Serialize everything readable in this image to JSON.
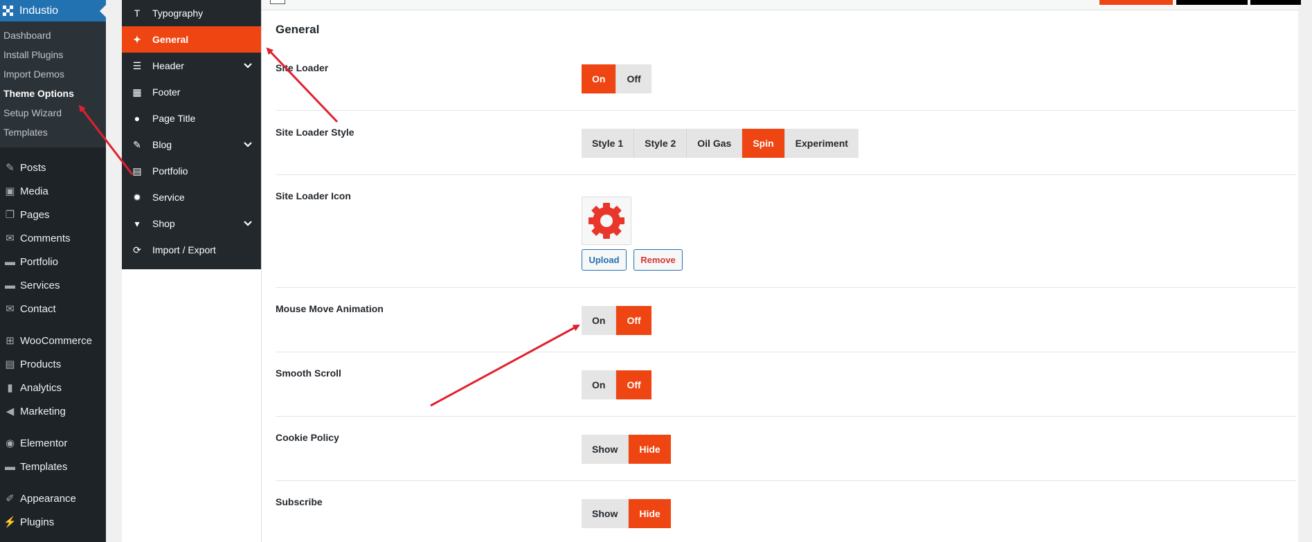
{
  "wp_menu": {
    "site_name": "Industio",
    "submenu": [
      "Dashboard",
      "Install Plugins",
      "Import Demos",
      "Theme Options",
      "Setup Wizard",
      "Templates"
    ],
    "current_submenu": "Theme Options",
    "items_group1": [
      {
        "label": "Posts",
        "icon": "pin-icon"
      },
      {
        "label": "Media",
        "icon": "media-icon"
      },
      {
        "label": "Pages",
        "icon": "pages-icon"
      },
      {
        "label": "Comments",
        "icon": "comments-icon"
      },
      {
        "label": "Portfolio",
        "icon": "folder-icon"
      },
      {
        "label": "Services",
        "icon": "folder-icon"
      },
      {
        "label": "Contact",
        "icon": "mail-icon"
      }
    ],
    "items_group2": [
      {
        "label": "WooCommerce",
        "icon": "woo-icon"
      },
      {
        "label": "Products",
        "icon": "archive-icon"
      },
      {
        "label": "Analytics",
        "icon": "bar-chart-icon"
      },
      {
        "label": "Marketing",
        "icon": "megaphone-icon"
      }
    ],
    "items_group3": [
      {
        "label": "Elementor",
        "icon": "elementor-icon"
      },
      {
        "label": "Templates",
        "icon": "folder-icon"
      }
    ],
    "items_group4": [
      {
        "label": "Appearance",
        "icon": "brush-icon"
      },
      {
        "label": "Plugins",
        "icon": "plug-icon"
      }
    ]
  },
  "options_nav": [
    {
      "label": "Typography",
      "icon": "text-icon",
      "has_children": false
    },
    {
      "label": "General",
      "icon": "wrench-icon",
      "has_children": false,
      "active": true
    },
    {
      "label": "Header",
      "icon": "indent-icon",
      "has_children": true
    },
    {
      "label": "Footer",
      "icon": "layout-icon",
      "has_children": false
    },
    {
      "label": "Page Title",
      "icon": "location-pin-icon",
      "has_children": false
    },
    {
      "label": "Blog",
      "icon": "edit-icon",
      "has_children": true
    },
    {
      "label": "Portfolio",
      "icon": "briefcase-icon",
      "has_children": false
    },
    {
      "label": "Service",
      "icon": "gear-icon",
      "has_children": false
    },
    {
      "label": "Shop",
      "icon": "cart-icon",
      "has_children": true
    },
    {
      "label": "Import / Export",
      "icon": "refresh-icon",
      "has_children": false
    }
  ],
  "section_title": "General",
  "options": {
    "site_loader": {
      "label": "Site Loader",
      "choices": [
        "On",
        "Off"
      ],
      "selected": "On"
    },
    "site_loader_style": {
      "label": "Site Loader Style",
      "choices": [
        "Style 1",
        "Style 2",
        "Oil Gas",
        "Spin",
        "Experiment"
      ],
      "selected": "Spin"
    },
    "site_loader_icon": {
      "label": "Site Loader Icon",
      "upload_label": "Upload",
      "remove_label": "Remove"
    },
    "mouse_move_animation": {
      "label": "Mouse Move Animation",
      "choices": [
        "On",
        "Off"
      ],
      "selected": "Off"
    },
    "smooth_scroll": {
      "label": "Smooth Scroll",
      "choices": [
        "On",
        "Off"
      ],
      "selected": "Off"
    },
    "cookie_policy": {
      "label": "Cookie Policy",
      "choices": [
        "Show",
        "Hide"
      ],
      "selected": "Hide"
    },
    "subscribe": {
      "label": "Subscribe",
      "choices": [
        "Show",
        "Hide"
      ],
      "selected": "Hide"
    }
  },
  "colors": {
    "accent": "#ee4512",
    "sidebar_bg": "#1d2327",
    "wp_blue": "#2271b1",
    "arrow": "#e0202e"
  }
}
